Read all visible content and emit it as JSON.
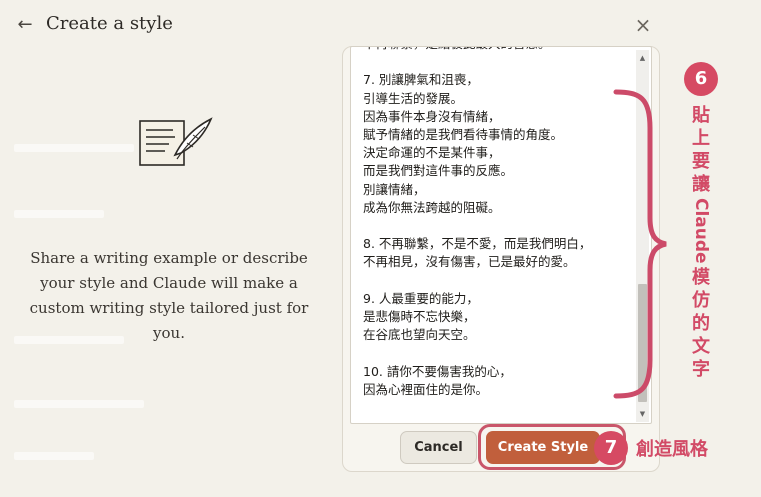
{
  "header": {
    "title": "Create a style",
    "back_icon": "arrow-left-icon",
    "close_icon": "close-icon"
  },
  "left": {
    "icon": "quill-writing-icon",
    "description": "Share a writing example or describe your style and Claude will make a custom writing style tailored just for you."
  },
  "sample": {
    "text": "不再聯繫，是給彼此最大的善意。\n\n7. 別讓脾氣和沮喪，\n引導生活的發展。\n因為事件本身沒有情緒，\n賦予情緒的是我們看待事情的角度。\n決定命運的不是某件事，\n而是我們對這件事的反應。\n別讓情緒，\n成為你無法跨越的阻礙。\n\n8. 不再聯繫，不是不愛，而是我們明白，\n不再相見，沒有傷害，已是最好的愛。\n\n9. 人最重要的能力，\n是悲傷時不忘快樂，\n在谷底也望向天空。\n\n10. 請你不要傷害我的心，\n因為心裡面住的是你。"
  },
  "buttons": {
    "cancel": "Cancel",
    "create": "Create Style"
  },
  "annotations": {
    "step6": "6",
    "step6_text_top": [
      "貼",
      "上",
      "要",
      "讓"
    ],
    "step6_text_latin": "Claude",
    "step6_text_bottom": [
      "模",
      "仿",
      "的",
      "文",
      "字"
    ],
    "step7": "7",
    "step7_text": "創造風格"
  },
  "colors": {
    "background": "#f3f1ea",
    "accent": "#c15f3c",
    "annotation": "#d24a66"
  }
}
